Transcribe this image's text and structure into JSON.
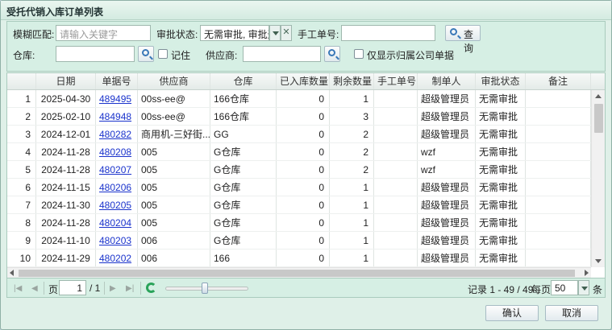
{
  "window": {
    "title": "受托代销入库订单列表"
  },
  "filters": {
    "fuzzy_label": "模糊匹配:",
    "fuzzy_placeholder": "请输入关键字",
    "approval_label": "审批状态:",
    "approval_value": "无需审批, 审批通",
    "manual_no_label": "手工单号:",
    "query_label": "查询",
    "warehouse_label": "仓库:",
    "remember_label": "记住",
    "supplier_label": "供应商:",
    "company_only_label": "仅显示归属公司单据"
  },
  "table": {
    "columns": [
      "日期",
      "单据号",
      "供应商",
      "仓库",
      "已入库数量",
      "剩余数量",
      "手工单号",
      "制单人",
      "审批状态",
      "备注"
    ],
    "rows": [
      {
        "idx": "1",
        "date": "2025-04-30",
        "no": "489495",
        "supplier": "00ss-ee@",
        "warehouse": "166仓库",
        "stocked": "0",
        "remaining": "1",
        "manual": "",
        "creator": "超级管理员",
        "status": "无需审批",
        "note": ""
      },
      {
        "idx": "2",
        "date": "2025-02-10",
        "no": "484948",
        "supplier": "00ss-ee@",
        "warehouse": "166仓库",
        "stocked": "0",
        "remaining": "3",
        "manual": "",
        "creator": "超级管理员",
        "status": "无需审批",
        "note": ""
      },
      {
        "idx": "3",
        "date": "2024-12-01",
        "no": "480282",
        "supplier": "商用机-三好街...",
        "warehouse": "GG",
        "stocked": "0",
        "remaining": "2",
        "manual": "",
        "creator": "超级管理员",
        "status": "无需审批",
        "note": ""
      },
      {
        "idx": "4",
        "date": "2024-11-28",
        "no": "480208",
        "supplier": "005",
        "warehouse": "G仓库",
        "stocked": "0",
        "remaining": "2",
        "manual": "",
        "creator": "wzf",
        "status": "无需审批",
        "note": ""
      },
      {
        "idx": "5",
        "date": "2024-11-28",
        "no": "480207",
        "supplier": "005",
        "warehouse": "G仓库",
        "stocked": "0",
        "remaining": "2",
        "manual": "",
        "creator": "wzf",
        "status": "无需审批",
        "note": ""
      },
      {
        "idx": "6",
        "date": "2024-11-15",
        "no": "480206",
        "supplier": "005",
        "warehouse": "G仓库",
        "stocked": "0",
        "remaining": "1",
        "manual": "",
        "creator": "超级管理员",
        "status": "无需审批",
        "note": ""
      },
      {
        "idx": "7",
        "date": "2024-11-30",
        "no": "480205",
        "supplier": "005",
        "warehouse": "G仓库",
        "stocked": "0",
        "remaining": "1",
        "manual": "",
        "creator": "超级管理员",
        "status": "无需审批",
        "note": ""
      },
      {
        "idx": "8",
        "date": "2024-11-28",
        "no": "480204",
        "supplier": "005",
        "warehouse": "G仓库",
        "stocked": "0",
        "remaining": "1",
        "manual": "",
        "creator": "超级管理员",
        "status": "无需审批",
        "note": ""
      },
      {
        "idx": "9",
        "date": "2024-11-10",
        "no": "480203",
        "supplier": "006",
        "warehouse": "G仓库",
        "stocked": "0",
        "remaining": "1",
        "manual": "",
        "creator": "超级管理员",
        "status": "无需审批",
        "note": ""
      },
      {
        "idx": "10",
        "date": "2024-11-29",
        "no": "480202",
        "supplier": "006",
        "warehouse": "166",
        "stocked": "0",
        "remaining": "1",
        "manual": "",
        "creator": "超级管理员",
        "status": "无需审批",
        "note": ""
      }
    ]
  },
  "pager": {
    "page_label": "页",
    "page_value": "1",
    "total_pages": "/ 1",
    "records_text": "记录 1 - 49 / 49",
    "per_page_label": "每页",
    "per_page_value": "50",
    "unit_label": "条"
  },
  "buttons": {
    "confirm": "确认",
    "cancel": "取消"
  }
}
